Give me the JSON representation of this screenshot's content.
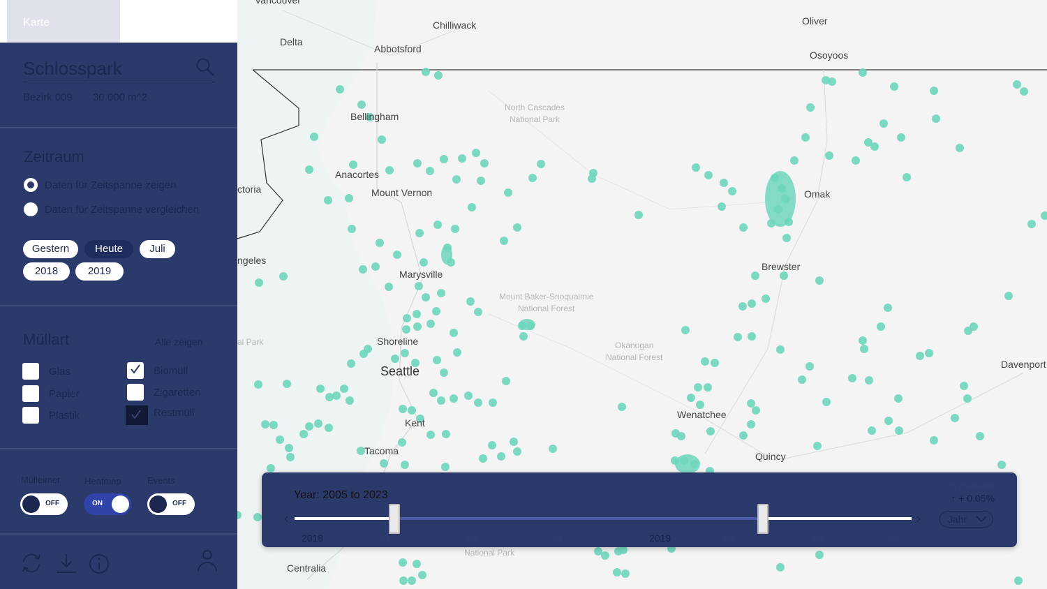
{
  "tabs": {
    "karte": "Karte"
  },
  "search": {
    "value": "Schlosspark"
  },
  "location": {
    "district": "Bezirk 009",
    "area": "30 000 m^2"
  },
  "zeitraum": {
    "title": "Zeitraum",
    "options": [
      "Daten für Zeitspanne zeigen",
      "Daten für Zeitspanne vergleichen"
    ],
    "selected": 0,
    "chips": [
      "Gestern",
      "Heute",
      "Juli",
      "2018",
      "2019"
    ],
    "active_chip": "Heute"
  },
  "muellart": {
    "title": "Müllart",
    "show_all": "Alle zeigen",
    "left": [
      {
        "label": "Glas",
        "checked": false
      },
      {
        "label": "Papier",
        "checked": false
      },
      {
        "label": "Plastik",
        "checked": false
      }
    ],
    "right": [
      {
        "label": "Biomüll",
        "checked": true
      },
      {
        "label": "Zigaretten",
        "checked": false
      },
      {
        "label": "Restmüll",
        "checked": true
      }
    ]
  },
  "toggles": [
    {
      "label": "Mülleimer",
      "state": "OFF"
    },
    {
      "label": "Heatmap",
      "state": "ON"
    },
    {
      "label": "Events",
      "state": "OFF"
    }
  ],
  "footer_icons": [
    "refresh-icon",
    "download-icon",
    "info-icon",
    "user-icon"
  ],
  "timeline": {
    "title": "Year: 2005 to 2023",
    "zeitraum_label": "Im Zeitraum",
    "change": "↑ + 0.05%",
    "select": "Jahr",
    "ticks": [
      "2018",
      "03",
      "06",
      "09",
      "2019",
      "03",
      "06",
      "09"
    ]
  },
  "map": {
    "cities": [
      "Vancouver",
      "Chilliwack",
      "Delta",
      "Abbotsford",
      "Oliver",
      "Osoyoos",
      "Bellingham",
      "Anacortes",
      "Mount Vernon",
      "ctoria",
      "Omak",
      "ngeles",
      "Marysville",
      "Brewster",
      "Shoreline",
      "Seattle",
      "Davenport",
      "Wenatchee",
      "Kent",
      "Tacoma",
      "Quincy",
      "Centralia"
    ],
    "parks": [
      "North Cascades\nNational Park",
      "Mount Baker-Snoqualmie\nNational Forest",
      "Okanogan\nNational Forest",
      "al Park",
      "National Park"
    ],
    "marker_color": "#6ed6bd"
  },
  "colors": {
    "sidebar": "#2b3a6b",
    "accent": "#2f43a8",
    "marker": "#6ed6bd"
  }
}
